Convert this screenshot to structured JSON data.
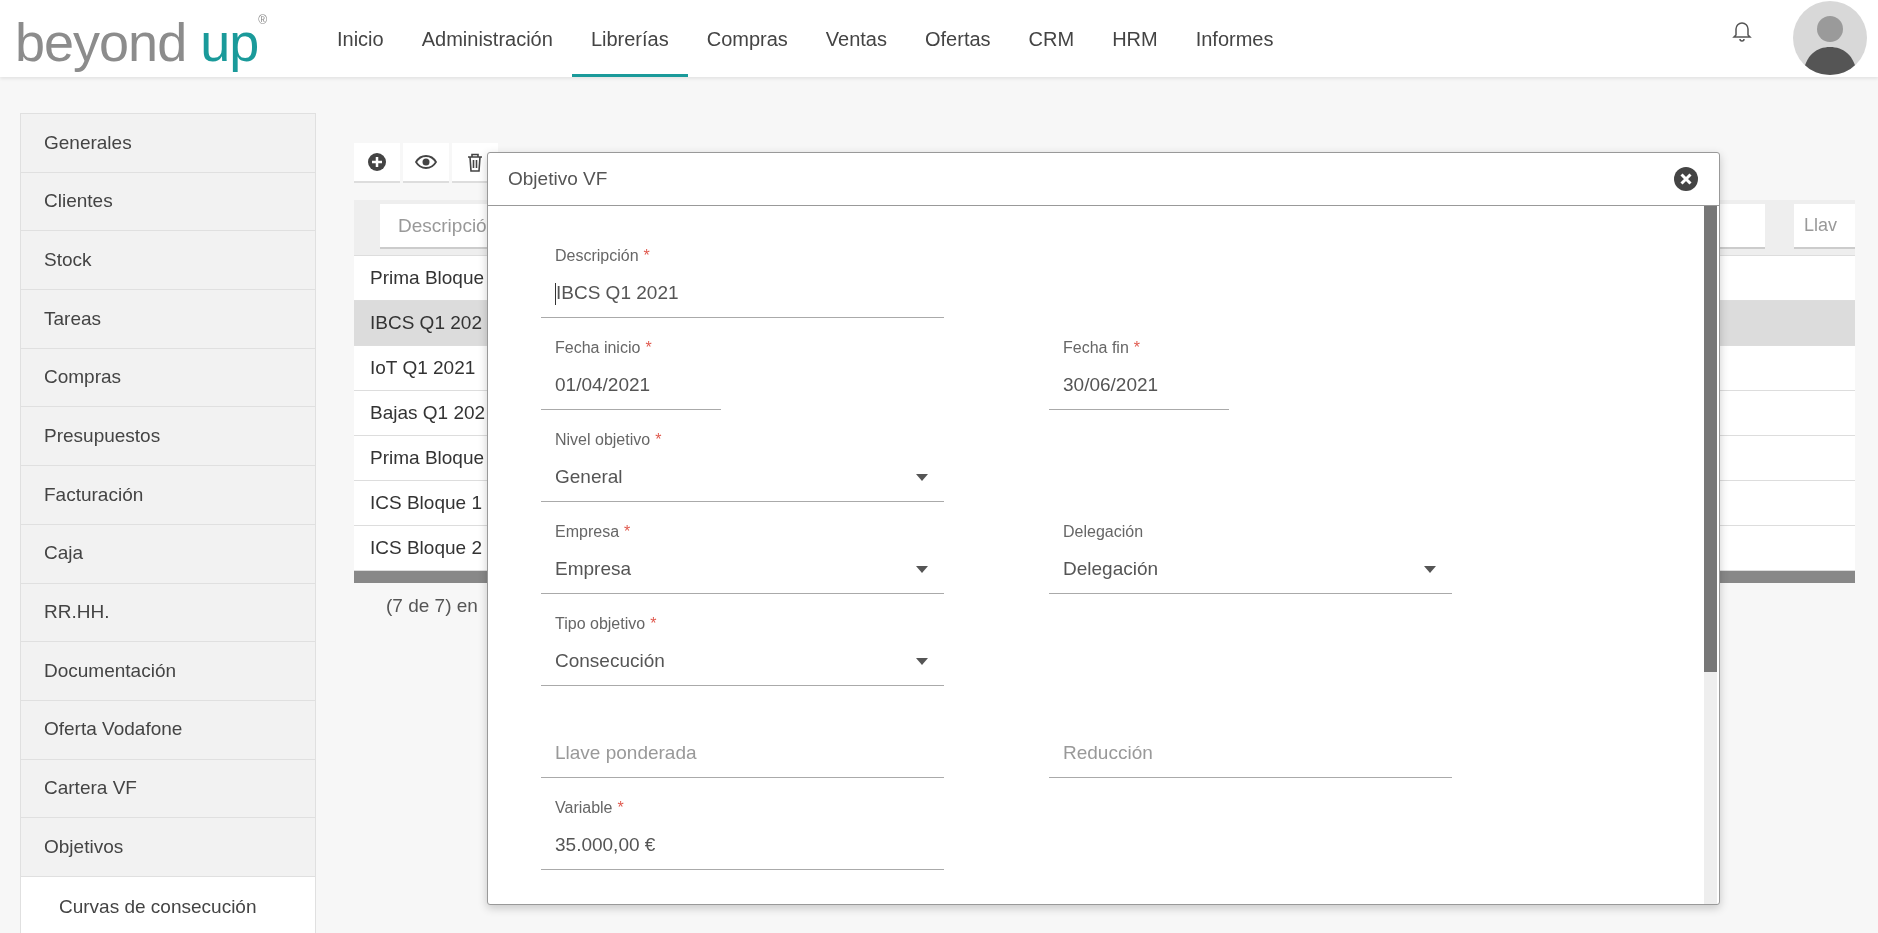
{
  "header": {
    "logo": {
      "word": "beyond",
      "accent": "up",
      "mark": "®"
    },
    "nav": [
      {
        "label": "Inicio",
        "selected": false
      },
      {
        "label": "Administración",
        "selected": false
      },
      {
        "label": "Librerías",
        "selected": true
      },
      {
        "label": "Compras",
        "selected": false
      },
      {
        "label": "Ventas",
        "selected": false
      },
      {
        "label": "Ofertas",
        "selected": false
      },
      {
        "label": "CRM",
        "selected": false
      },
      {
        "label": "HRM",
        "selected": false
      },
      {
        "label": "Informes",
        "selected": false
      }
    ]
  },
  "sidebar": {
    "items": [
      {
        "label": "Generales"
      },
      {
        "label": "Clientes"
      },
      {
        "label": "Stock"
      },
      {
        "label": "Tareas"
      },
      {
        "label": "Compras"
      },
      {
        "label": "Presupuestos"
      },
      {
        "label": "Facturación"
      },
      {
        "label": "Caja"
      },
      {
        "label": "RR.HH."
      },
      {
        "label": "Documentación"
      },
      {
        "label": "Oferta Vodafone"
      },
      {
        "label": "Cartera VF"
      },
      {
        "label": "Objetivos",
        "expanded": true,
        "children": [
          {
            "label": "Curvas de consecución"
          }
        ]
      }
    ]
  },
  "table": {
    "filters": [
      {
        "placeholder": "Descripció"
      },
      {
        "placeholder": "Llav"
      }
    ],
    "rows": [
      {
        "cell": "Prima Bloque",
        "selected": false
      },
      {
        "cell": "IBCS Q1 202",
        "selected": true
      },
      {
        "cell": "IoT Q1 2021",
        "selected": false
      },
      {
        "cell": "Bajas Q1 202",
        "selected": false
      },
      {
        "cell": "Prima Bloque",
        "selected": false
      },
      {
        "cell": "ICS Bloque 1",
        "selected": false
      },
      {
        "cell": "ICS Bloque 2",
        "selected": false
      }
    ],
    "pager": "(7 de 7) en"
  },
  "dialog": {
    "title": "Objetivo VF",
    "rows": [
      [
        {
          "kind": "text",
          "label": "Descripción",
          "required_mark": "*",
          "value": "IBCS Q1 2021",
          "focused": true
        }
      ],
      [
        {
          "kind": "date",
          "label": "Fecha inicio",
          "required_mark": "*",
          "value": "01/04/2021",
          "focused": false
        },
        {
          "kind": "date",
          "label": "Fecha fin",
          "required_mark": "*",
          "value": "30/06/2021",
          "focused": false
        }
      ],
      [
        {
          "kind": "select",
          "label": "Nivel objetivo",
          "required_mark": "*",
          "value": "General",
          "focused": false
        }
      ],
      [
        {
          "kind": "select",
          "label": "Empresa",
          "required_mark": "*",
          "value": "Empresa",
          "focused": false
        },
        {
          "kind": "select",
          "label": "Delegación",
          "value": "Delegación",
          "focused": false
        }
      ],
      [
        {
          "kind": "select",
          "label": "Tipo objetivo",
          "required_mark": "*",
          "value": "Consecución",
          "focused": false
        }
      ],
      [
        {
          "kind": "text",
          "placeholder": "Llave ponderada",
          "focused": false
        },
        {
          "kind": "text",
          "placeholder": "Reducción",
          "focused": false
        }
      ],
      [
        {
          "kind": "text",
          "label": "Variable",
          "required_mark": "*",
          "value": "35.000,00 €",
          "focused": false
        }
      ]
    ]
  }
}
